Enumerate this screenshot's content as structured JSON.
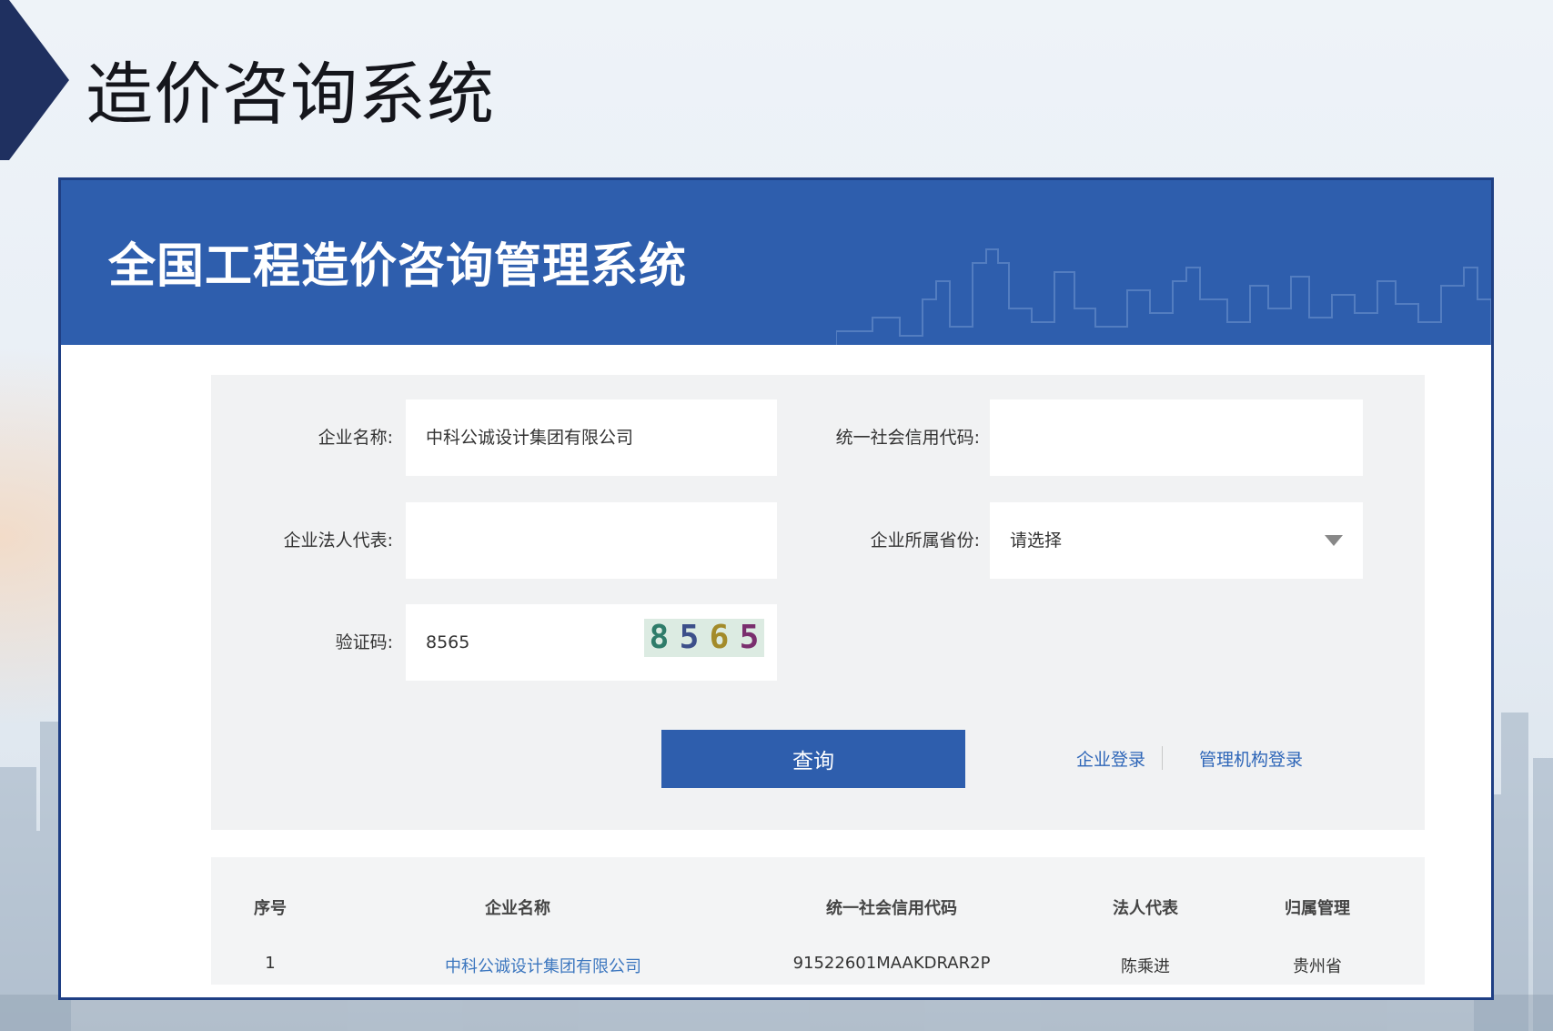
{
  "slide": {
    "title": "造价咨询系统"
  },
  "app": {
    "title": "全国工程造价咨询管理系统"
  },
  "form": {
    "company_name": {
      "label": "企业名称:",
      "value": "中科公诚设计集团有限公司"
    },
    "credit_code": {
      "label": "统一社会信用代码:",
      "value": ""
    },
    "legal_rep": {
      "label": "企业法人代表:",
      "value": ""
    },
    "province": {
      "label": "企业所属省份:",
      "value": "请选择"
    },
    "captcha": {
      "label": "验证码:",
      "value": "8565",
      "digits": [
        "8",
        "5",
        "6",
        "5"
      ]
    },
    "query_button": "查询",
    "links": {
      "company_login": "企业登录",
      "admin_login": "管理机构登录"
    }
  },
  "table": {
    "headers": {
      "index": "序号",
      "name": "企业名称",
      "code": "统一社会信用代码",
      "rep": "法人代表",
      "region": "归属管理"
    },
    "rows": [
      {
        "index": "1",
        "name": "中科公诚设计集团有限公司",
        "code": "91522601MAAKDRAR2P",
        "rep": "陈乘进",
        "region": "贵州省"
      }
    ]
  },
  "colors": {
    "primary": "#2e5ead",
    "link": "#2e66b8",
    "dark_navy": "#1f3060"
  }
}
